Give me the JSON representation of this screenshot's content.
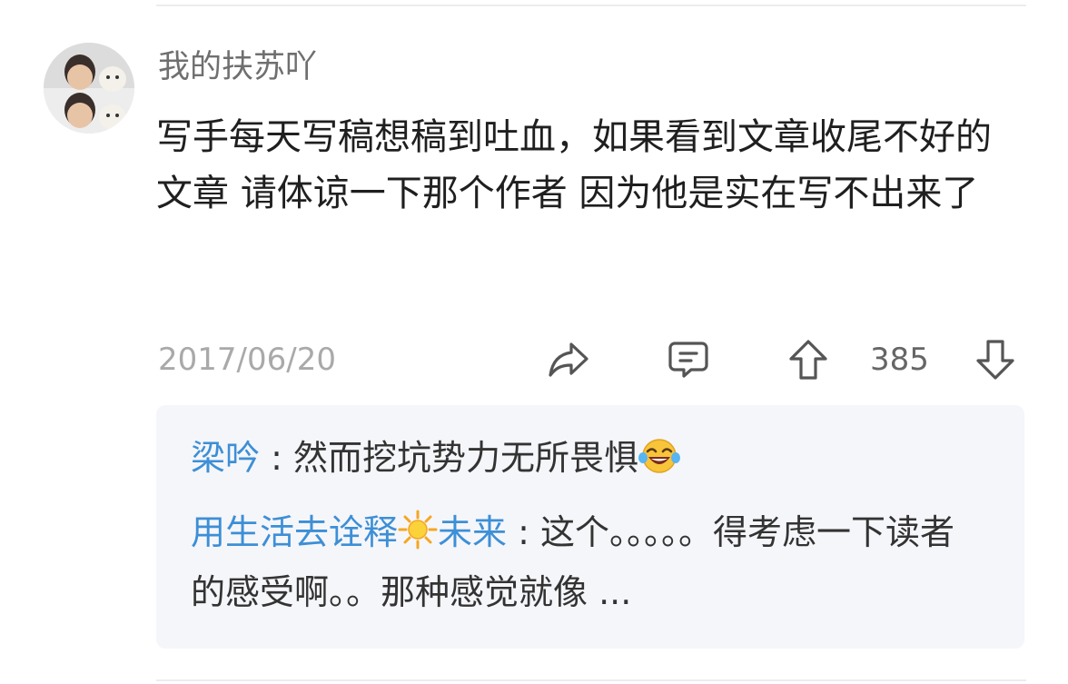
{
  "post": {
    "username": "我的扶苏吖",
    "body": "写手每天写稿想稿到吐血，如果看到文章收尾不好的文章 请体谅一下那个作者 因为他是实在写不出来了",
    "date": "2017/06/20",
    "vote_count": "385"
  },
  "icons": {
    "share": "share-arrow-icon",
    "comment": "comment-bubble-icon",
    "upvote": "upvote-arrow-icon",
    "downvote": "downvote-arrow-icon",
    "emoji_laugh": "tears-of-joy-emoji",
    "sun": "sun-emoji"
  },
  "replies": [
    {
      "author": "梁吟",
      "separator": " : ",
      "text": "然而挖坑势力无所畏惧"
    },
    {
      "author_part1": "用生活去诠释",
      "author_part2": "未来",
      "separator": " : ",
      "text": "这个。。。。。得考虑一下读者的感受啊。。那种感觉就像 ..."
    }
  ],
  "colors": {
    "reply_author": "#3d8fd6",
    "reply_bg": "#f5f6fa",
    "date": "#a9a9a9"
  }
}
